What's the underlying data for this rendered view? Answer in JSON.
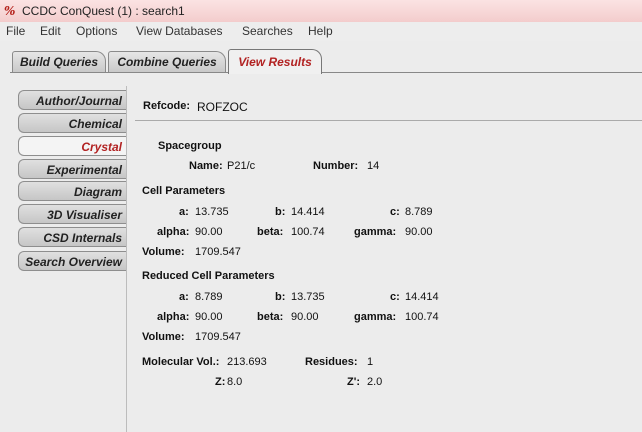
{
  "window": {
    "title": "CCDC ConQuest (1) : search1",
    "icon": "conquest-logo-icon"
  },
  "menu": [
    "File",
    "Edit",
    "Options",
    "View Databases",
    "Searches",
    "Help"
  ],
  "top_tabs": [
    {
      "label": "Build Queries",
      "active": false
    },
    {
      "label": "Combine Queries",
      "active": false
    },
    {
      "label": "View Results",
      "active": true
    }
  ],
  "side_tabs": [
    {
      "label": "Author/Journal",
      "active": false
    },
    {
      "label": "Chemical",
      "active": false
    },
    {
      "label": "Crystal",
      "active": true
    },
    {
      "label": "Experimental",
      "active": false
    },
    {
      "label": "Diagram",
      "active": false
    },
    {
      "label": "3D Visualiser",
      "active": false
    },
    {
      "label": "CSD Internals",
      "active": false
    },
    {
      "label": "Search Overview",
      "active": false
    }
  ],
  "refcode": {
    "label": "Refcode:",
    "value": "ROFZOC"
  },
  "spacegroup": {
    "heading": "Spacegroup",
    "name_label": "Name:",
    "name": "P21/c",
    "number_label": "Number:",
    "number": "14"
  },
  "cell": {
    "heading": "Cell Parameters",
    "a_label": "a:",
    "a": "13.735",
    "b_label": "b:",
    "b": "14.414",
    "c_label": "c:",
    "c": "8.789",
    "alpha_label": "alpha:",
    "alpha": "90.00",
    "beta_label": "beta:",
    "beta": "100.74",
    "gamma_label": "gamma:",
    "gamma": "90.00",
    "volume_label": "Volume:",
    "volume": "1709.547"
  },
  "reduced_cell": {
    "heading": "Reduced Cell Parameters",
    "a_label": "a:",
    "a": "8.789",
    "b_label": "b:",
    "b": "13.735",
    "c_label": "c:",
    "c": "14.414",
    "alpha_label": "alpha:",
    "alpha": "90.00",
    "beta_label": "beta:",
    "beta": "90.00",
    "gamma_label": "gamma:",
    "gamma": "100.74",
    "volume_label": "Volume:",
    "volume": "1709.547"
  },
  "misc": {
    "mol_vol_label": "Molecular Vol.:",
    "mol_vol": "213.693",
    "residues_label": "Residues:",
    "residues": "1",
    "z_label": "Z:",
    "z": "8.0",
    "zprime_label": "Z':",
    "zprime": "2.0"
  }
}
